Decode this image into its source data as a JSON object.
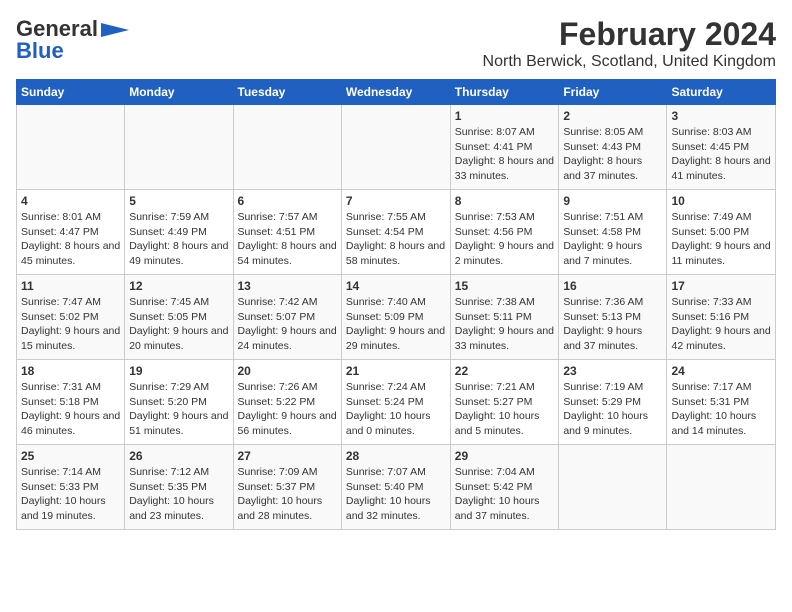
{
  "header": {
    "logo_general": "General",
    "logo_blue": "Blue",
    "title": "February 2024",
    "subtitle": "North Berwick, Scotland, United Kingdom"
  },
  "days_of_week": [
    "Sunday",
    "Monday",
    "Tuesday",
    "Wednesday",
    "Thursday",
    "Friday",
    "Saturday"
  ],
  "weeks": [
    [
      {
        "day": "",
        "content": ""
      },
      {
        "day": "",
        "content": ""
      },
      {
        "day": "",
        "content": ""
      },
      {
        "day": "",
        "content": ""
      },
      {
        "day": "1",
        "content": "Sunrise: 8:07 AM\nSunset: 4:41 PM\nDaylight: 8 hours and 33 minutes."
      },
      {
        "day": "2",
        "content": "Sunrise: 8:05 AM\nSunset: 4:43 PM\nDaylight: 8 hours and 37 minutes."
      },
      {
        "day": "3",
        "content": "Sunrise: 8:03 AM\nSunset: 4:45 PM\nDaylight: 8 hours and 41 minutes."
      }
    ],
    [
      {
        "day": "4",
        "content": "Sunrise: 8:01 AM\nSunset: 4:47 PM\nDaylight: 8 hours and 45 minutes."
      },
      {
        "day": "5",
        "content": "Sunrise: 7:59 AM\nSunset: 4:49 PM\nDaylight: 8 hours and 49 minutes."
      },
      {
        "day": "6",
        "content": "Sunrise: 7:57 AM\nSunset: 4:51 PM\nDaylight: 8 hours and 54 minutes."
      },
      {
        "day": "7",
        "content": "Sunrise: 7:55 AM\nSunset: 4:54 PM\nDaylight: 8 hours and 58 minutes."
      },
      {
        "day": "8",
        "content": "Sunrise: 7:53 AM\nSunset: 4:56 PM\nDaylight: 9 hours and 2 minutes."
      },
      {
        "day": "9",
        "content": "Sunrise: 7:51 AM\nSunset: 4:58 PM\nDaylight: 9 hours and 7 minutes."
      },
      {
        "day": "10",
        "content": "Sunrise: 7:49 AM\nSunset: 5:00 PM\nDaylight: 9 hours and 11 minutes."
      }
    ],
    [
      {
        "day": "11",
        "content": "Sunrise: 7:47 AM\nSunset: 5:02 PM\nDaylight: 9 hours and 15 minutes."
      },
      {
        "day": "12",
        "content": "Sunrise: 7:45 AM\nSunset: 5:05 PM\nDaylight: 9 hours and 20 minutes."
      },
      {
        "day": "13",
        "content": "Sunrise: 7:42 AM\nSunset: 5:07 PM\nDaylight: 9 hours and 24 minutes."
      },
      {
        "day": "14",
        "content": "Sunrise: 7:40 AM\nSunset: 5:09 PM\nDaylight: 9 hours and 29 minutes."
      },
      {
        "day": "15",
        "content": "Sunrise: 7:38 AM\nSunset: 5:11 PM\nDaylight: 9 hours and 33 minutes."
      },
      {
        "day": "16",
        "content": "Sunrise: 7:36 AM\nSunset: 5:13 PM\nDaylight: 9 hours and 37 minutes."
      },
      {
        "day": "17",
        "content": "Sunrise: 7:33 AM\nSunset: 5:16 PM\nDaylight: 9 hours and 42 minutes."
      }
    ],
    [
      {
        "day": "18",
        "content": "Sunrise: 7:31 AM\nSunset: 5:18 PM\nDaylight: 9 hours and 46 minutes."
      },
      {
        "day": "19",
        "content": "Sunrise: 7:29 AM\nSunset: 5:20 PM\nDaylight: 9 hours and 51 minutes."
      },
      {
        "day": "20",
        "content": "Sunrise: 7:26 AM\nSunset: 5:22 PM\nDaylight: 9 hours and 56 minutes."
      },
      {
        "day": "21",
        "content": "Sunrise: 7:24 AM\nSunset: 5:24 PM\nDaylight: 10 hours and 0 minutes."
      },
      {
        "day": "22",
        "content": "Sunrise: 7:21 AM\nSunset: 5:27 PM\nDaylight: 10 hours and 5 minutes."
      },
      {
        "day": "23",
        "content": "Sunrise: 7:19 AM\nSunset: 5:29 PM\nDaylight: 10 hours and 9 minutes."
      },
      {
        "day": "24",
        "content": "Sunrise: 7:17 AM\nSunset: 5:31 PM\nDaylight: 10 hours and 14 minutes."
      }
    ],
    [
      {
        "day": "25",
        "content": "Sunrise: 7:14 AM\nSunset: 5:33 PM\nDaylight: 10 hours and 19 minutes."
      },
      {
        "day": "26",
        "content": "Sunrise: 7:12 AM\nSunset: 5:35 PM\nDaylight: 10 hours and 23 minutes."
      },
      {
        "day": "27",
        "content": "Sunrise: 7:09 AM\nSunset: 5:37 PM\nDaylight: 10 hours and 28 minutes."
      },
      {
        "day": "28",
        "content": "Sunrise: 7:07 AM\nSunset: 5:40 PM\nDaylight: 10 hours and 32 minutes."
      },
      {
        "day": "29",
        "content": "Sunrise: 7:04 AM\nSunset: 5:42 PM\nDaylight: 10 hours and 37 minutes."
      },
      {
        "day": "",
        "content": ""
      },
      {
        "day": "",
        "content": ""
      }
    ]
  ]
}
